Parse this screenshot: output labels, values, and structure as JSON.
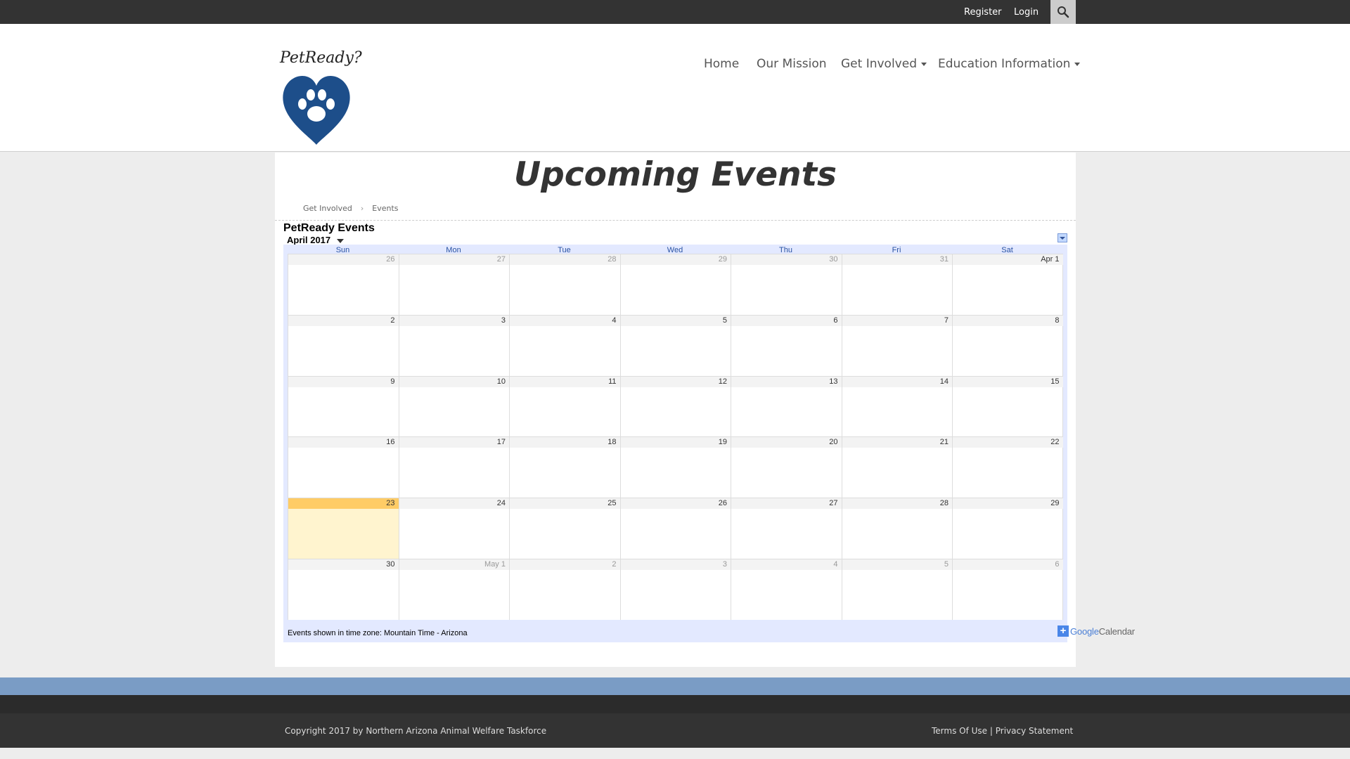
{
  "topbar": {
    "register_label": "Register",
    "login_label": "Login",
    "search_icon": "search-icon"
  },
  "logo": {
    "text": "PetReady?",
    "icon": "heart-paw-icon",
    "color": "#1d4e8a"
  },
  "nav": {
    "items": [
      {
        "label": "Home",
        "dropdown": false
      },
      {
        "label": "Our Mission",
        "dropdown": false
      },
      {
        "label": "Get Involved",
        "dropdown": true
      },
      {
        "label": "Education Information",
        "dropdown": true
      }
    ]
  },
  "page": {
    "title": "Upcoming Events",
    "breadcrumb": [
      "Get Involved",
      "Events"
    ]
  },
  "calendar": {
    "title": "PetReady Events",
    "month_label": "April 2017",
    "days_of_week": [
      "Sun",
      "Mon",
      "Tue",
      "Wed",
      "Thu",
      "Fri",
      "Sat"
    ],
    "weeks": [
      [
        "26",
        "27",
        "28",
        "29",
        "30",
        "31",
        "Apr 1"
      ],
      [
        "2",
        "3",
        "4",
        "5",
        "6",
        "7",
        "8"
      ],
      [
        "9",
        "10",
        "11",
        "12",
        "13",
        "14",
        "15"
      ],
      [
        "16",
        "17",
        "18",
        "19",
        "20",
        "21",
        "22"
      ],
      [
        "23",
        "24",
        "25",
        "26",
        "27",
        "28",
        "29"
      ],
      [
        "30",
        "May 1",
        "2",
        "3",
        "4",
        "5",
        "6"
      ]
    ],
    "today": "23",
    "timezone_note": "Events shown in time zone: Mountain Time - Arizona",
    "gcal_button": {
      "google": "Google",
      "calendar": "Calendar"
    },
    "colors": {
      "today_header": "#ffcc66",
      "today_body": "#fff4cf",
      "frame": "#e3e9ff",
      "dow_text": "#2952a3"
    }
  },
  "footer": {
    "copyright": "Copyright 2017 by Northern Arizona Animal Welfare Taskforce",
    "terms_label": "Terms Of Use",
    "separator": "|",
    "privacy_label": "Privacy Statement",
    "accent_color": "#7a9cc5"
  }
}
